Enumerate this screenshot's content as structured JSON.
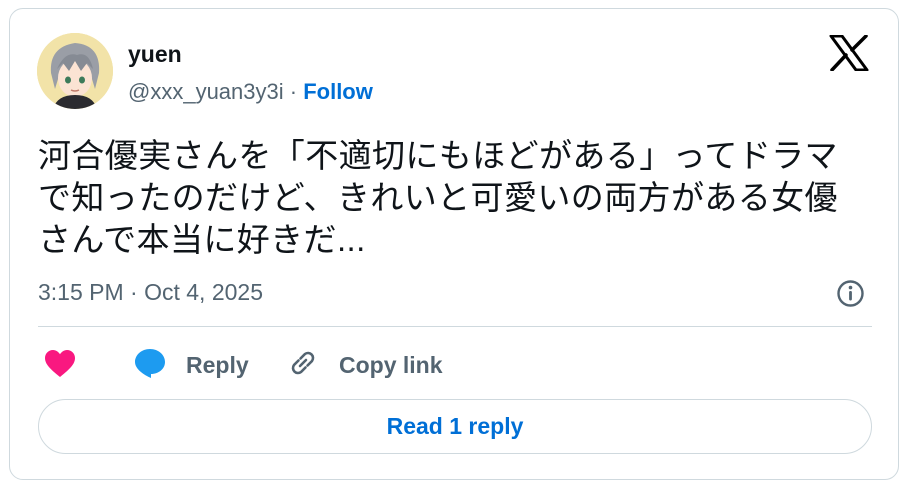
{
  "author": {
    "name": "yuen",
    "handle": "@xxx_yuan3y3i",
    "separator": " · ",
    "follow_label": "Follow"
  },
  "tweet": {
    "text": "河合優実さんを「不適切にもほどがある」ってドラマで知ったのだけど、きれいと可愛いの両方がある女優さんで本当に好きだ...",
    "timestamp": "3:15 PM · Oct 4, 2025"
  },
  "actions": {
    "reply_label": "Reply",
    "copy_link_label": "Copy link"
  },
  "read_replies_label": "Read 1 reply",
  "colors": {
    "link_blue": "#006fd6",
    "heart_pink": "#f91880",
    "reply_bubble": "#1d9bf0",
    "muted_text": "#536471",
    "border": "#cfd9de"
  },
  "icons": [
    "avatar",
    "x-logo-icon",
    "info-icon",
    "heart-icon",
    "reply-bubble-icon",
    "link-icon"
  ]
}
